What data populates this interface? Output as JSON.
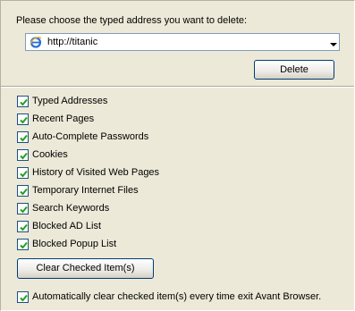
{
  "prompt": "Please choose the typed address you want to delete:",
  "address_combo": {
    "value": "http://titanic",
    "icon": "ie-icon"
  },
  "delete_button": "Delete",
  "checklist": [
    {
      "label": "Typed Addresses",
      "checked": true
    },
    {
      "label": "Recent Pages",
      "checked": true
    },
    {
      "label": "Auto-Complete Passwords",
      "checked": true
    },
    {
      "label": "Cookies",
      "checked": true
    },
    {
      "label": "History of Visited Web Pages",
      "checked": true
    },
    {
      "label": "Temporary Internet Files",
      "checked": true
    },
    {
      "label": "Search Keywords",
      "checked": true
    },
    {
      "label": "Blocked AD List",
      "checked": true
    },
    {
      "label": "Blocked Popup List",
      "checked": true
    }
  ],
  "clear_button": "Clear Checked Item(s)",
  "auto_clear": {
    "label": "Automatically clear checked item(s) every time exit Avant Browser.",
    "checked": true
  },
  "colors": {
    "panel": "#ece9d8",
    "check_mark": "#21a121",
    "button_border": "#003c74"
  }
}
